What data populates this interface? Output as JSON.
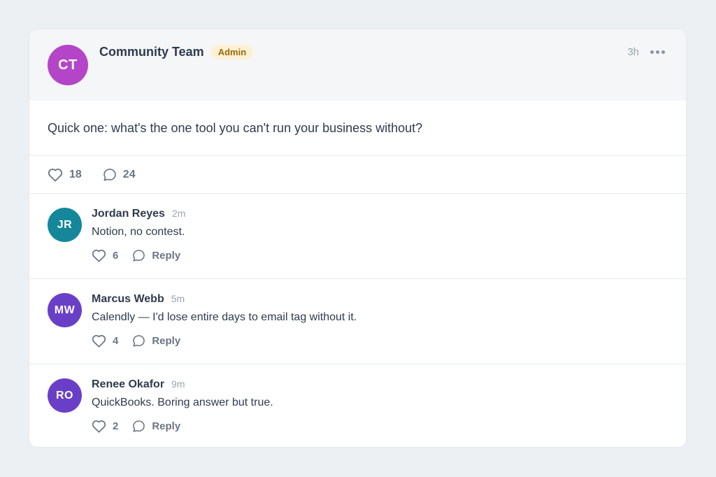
{
  "post": {
    "author": {
      "initials": "CT",
      "name": "Community Team",
      "badge": "Admin",
      "avatar_color": "#b545c8"
    },
    "time": "3h",
    "menu_icon": "more-horizontal-icon",
    "body": "Quick one: what's the one tool you can't run your business without?",
    "likes": "18",
    "comments": "24"
  },
  "comments": [
    {
      "initials": "JR",
      "avatar_color": "#14889a",
      "name": "Jordan Reyes",
      "time": "2m",
      "text": "Notion, no contest.",
      "likes": "6",
      "reply_label": "Reply"
    },
    {
      "initials": "MW",
      "avatar_color": "#6a3fc8",
      "name": "Marcus Webb",
      "time": "5m",
      "text": "Calendly — I'd lose entire days to email tag without it.",
      "likes": "4",
      "reply_label": "Reply"
    },
    {
      "initials": "RO",
      "avatar_color": "#6a3fc8",
      "name": "Renee Okafor",
      "time": "9m",
      "text": "QuickBooks. Boring answer but true.",
      "likes": "2",
      "reply_label": "Reply"
    }
  ],
  "colors": {
    "background": "#edf0f3",
    "header_background": "#f4f6f8",
    "badge_background": "#fdf1d3",
    "badge_text": "#9a6a0c",
    "text_primary": "#2f3b4d",
    "text_muted": "#6b7684"
  }
}
